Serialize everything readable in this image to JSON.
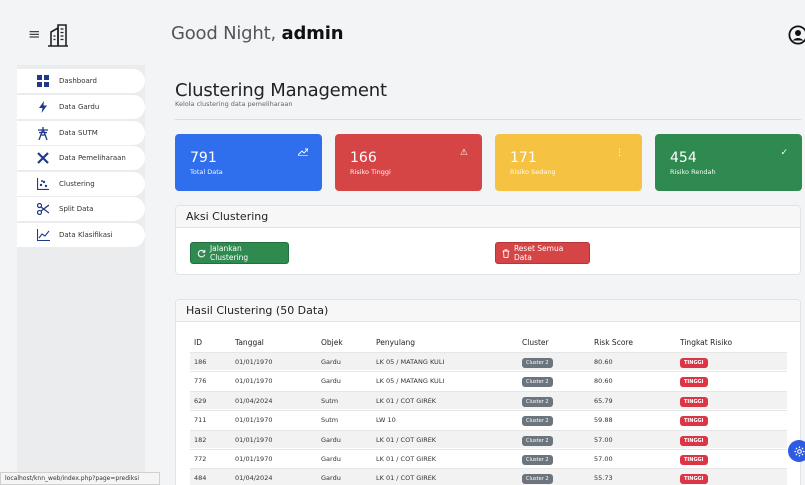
{
  "header": {
    "greeting_prefix": "Good Night,",
    "greeting_user": "admin"
  },
  "sidebar": {
    "items": [
      {
        "label": "Dashboard",
        "icon": "dashboard-grid-icon"
      },
      {
        "label": "Data Gardu",
        "icon": "bolt-icon"
      },
      {
        "label": "Data SUTM",
        "icon": "tower-icon"
      },
      {
        "label": "Data Pemeliharaan",
        "icon": "tools-icon"
      },
      {
        "label": "Clustering",
        "icon": "scatter-icon"
      },
      {
        "label": "Split Data",
        "icon": "scissors-icon"
      },
      {
        "label": "Data Klasifikasi",
        "icon": "line-chart-icon"
      }
    ]
  },
  "page": {
    "title": "Clustering Management",
    "subtitle": "Kelola clustering data pemeliharaan"
  },
  "stats": [
    {
      "value": "791",
      "label": "Total Data",
      "color": "#2f6fed",
      "icon": "trend-up-icon"
    },
    {
      "value": "166",
      "label": "Risiko Tinggi",
      "color": "#d64545",
      "icon": "warning-icon"
    },
    {
      "value": "171",
      "label": "Risiko Sedang",
      "color": "#f5c242",
      "icon": "info-icon"
    },
    {
      "value": "454",
      "label": "Risiko Rendah",
      "color": "#2e8a4f",
      "icon": "check-icon"
    }
  ],
  "actions": {
    "title": "Aksi Clustering",
    "run_label": "Jalankan Clustering",
    "reset_label": "Reset Semua Data",
    "run_color": "#2e8a4f",
    "reset_color": "#d64545"
  },
  "results": {
    "title": "Hasil Clustering (50 Data)",
    "columns": [
      "ID",
      "Tanggal",
      "Objek",
      "Penyulang",
      "Cluster",
      "Risk Score",
      "Tingkat Risiko"
    ],
    "rows": [
      {
        "id": "186",
        "tanggal": "01/01/1970",
        "objek": "Gardu",
        "penyulang": "LK 05 / MATANG KULI",
        "cluster": "Cluster 2",
        "score": "80.60",
        "risk": "TINGGI"
      },
      {
        "id": "776",
        "tanggal": "01/01/1970",
        "objek": "Gardu",
        "penyulang": "LK 05 / MATANG KULI",
        "cluster": "Cluster 2",
        "score": "80.60",
        "risk": "TINGGI"
      },
      {
        "id": "629",
        "tanggal": "01/04/2024",
        "objek": "Sutm",
        "penyulang": "LK 01 / COT GIREK",
        "cluster": "Cluster 2",
        "score": "65.79",
        "risk": "TINGGI"
      },
      {
        "id": "711",
        "tanggal": "01/01/1970",
        "objek": "Sutm",
        "penyulang": "LW 10",
        "cluster": "Cluster 2",
        "score": "59.88",
        "risk": "TINGGI"
      },
      {
        "id": "182",
        "tanggal": "01/01/1970",
        "objek": "Gardu",
        "penyulang": "LK 01 / COT GIREK",
        "cluster": "Cluster 2",
        "score": "57.00",
        "risk": "TINGGI"
      },
      {
        "id": "772",
        "tanggal": "01/01/1970",
        "objek": "Gardu",
        "penyulang": "LK 01 / COT GIREK",
        "cluster": "Cluster 2",
        "score": "57.00",
        "risk": "TINGGI"
      },
      {
        "id": "484",
        "tanggal": "01/04/2024",
        "objek": "Gardu",
        "penyulang": "LK 01 / COT GIREK",
        "cluster": "Cluster 2",
        "score": "55.73",
        "risk": "TINGGI"
      }
    ]
  },
  "statusbar": {
    "url": "localhost/knn_web/index.php?page=prediksi"
  }
}
